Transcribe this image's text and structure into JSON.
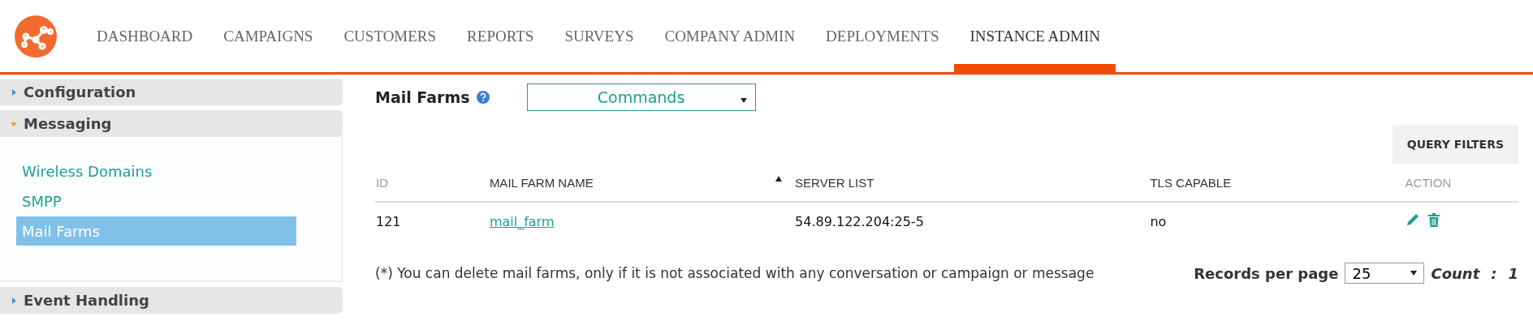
{
  "nav": {
    "items": [
      {
        "label": "DASHBOARD",
        "selected": false
      },
      {
        "label": "CAMPAIGNS",
        "selected": false
      },
      {
        "label": "CUSTOMERS",
        "selected": false
      },
      {
        "label": "REPORTS",
        "selected": false
      },
      {
        "label": "SURVEYS",
        "selected": false
      },
      {
        "label": "COMPANY ADMIN",
        "selected": false
      },
      {
        "label": "DEPLOYMENTS",
        "selected": false
      },
      {
        "label": "INSTANCE ADMIN",
        "selected": true
      }
    ]
  },
  "sidebar": {
    "sections": [
      {
        "label": "Configuration",
        "expanded": false
      },
      {
        "label": "Messaging",
        "expanded": true,
        "items": [
          {
            "label": "Wireless Domains",
            "selected": false
          },
          {
            "label": "SMPP",
            "selected": false
          },
          {
            "label": "Mail Farms",
            "selected": true
          }
        ]
      },
      {
        "label": "Event Handling",
        "expanded": false
      }
    ]
  },
  "page": {
    "title": "Mail Farms",
    "commands": {
      "value": "Commands"
    },
    "query_filters_button": "QUERY FILTERS"
  },
  "table": {
    "columns": [
      {
        "label": "ID",
        "sorted": false,
        "muted": true
      },
      {
        "label": "MAIL FARM NAME",
        "sorted": true,
        "muted": false
      },
      {
        "label": "SERVER LIST",
        "sorted": false,
        "muted": false
      },
      {
        "label": "TLS CAPABLE",
        "sorted": false,
        "muted": false
      },
      {
        "label": "ACTION",
        "sorted": false,
        "muted": true
      }
    ],
    "rows": [
      {
        "id": "121",
        "name": "mail_farm",
        "server_list": "54.89.122.204:25-5",
        "tls_capable": "no"
      }
    ]
  },
  "note": "(*) You can delete mail farms, only if it is not associated with any conversation or campaign or message",
  "pagination": {
    "label": "Records per page",
    "per_page": "25",
    "count_label": "Count",
    "count_separator": ":",
    "count": "1"
  }
}
